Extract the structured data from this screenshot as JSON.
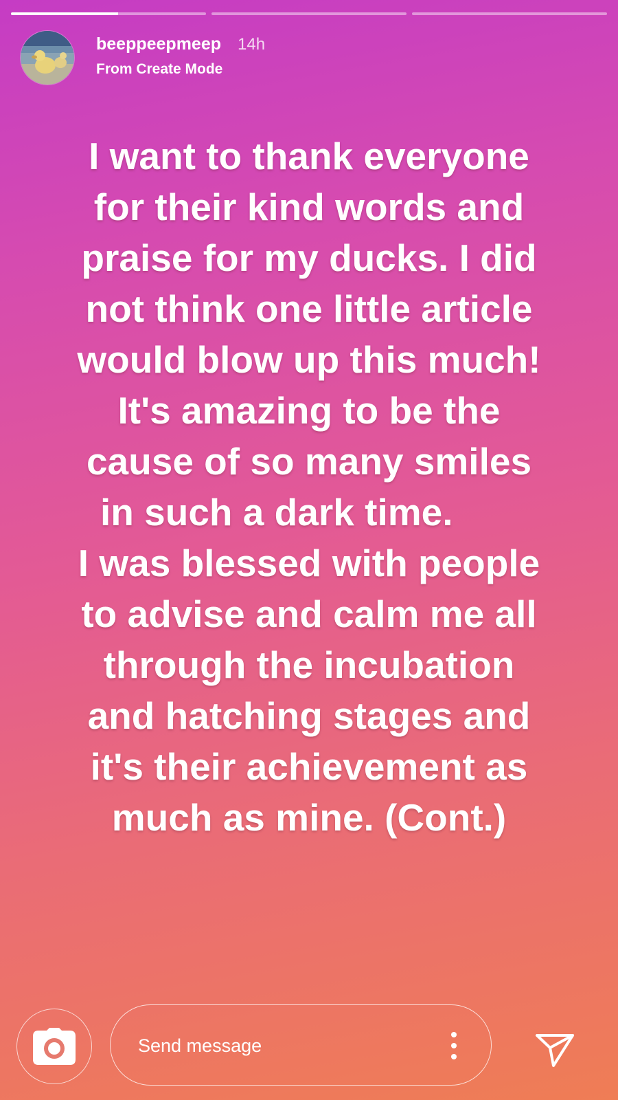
{
  "progress": {
    "segments": [
      {
        "fill": 0.55
      },
      {
        "fill": 0
      },
      {
        "fill": 0
      }
    ]
  },
  "header": {
    "username": "beeppeepmeep",
    "time": "14h",
    "subtitle": "From Create Mode"
  },
  "story": {
    "background_colors": [
      "#c53cc4",
      "#e35a95",
      "#ef7d55"
    ],
    "lines": [
      "I want to thank everyone",
      "for their kind words and",
      "praise for my ducks. I did",
      "not think one little article",
      "would blow up this much!",
      "It's amazing to be the",
      "cause of so many smiles",
      "in such a dark time.",
      "I was blessed with people",
      "to advise and calm me all",
      "through the incubation",
      "and hatching stages and",
      "it's their achievement as",
      "much as mine. (Cont.)"
    ]
  },
  "footer": {
    "message_placeholder": "Send message",
    "icons": {
      "camera": "camera-icon",
      "more": "more-vertical-icon",
      "send": "send-icon"
    }
  }
}
